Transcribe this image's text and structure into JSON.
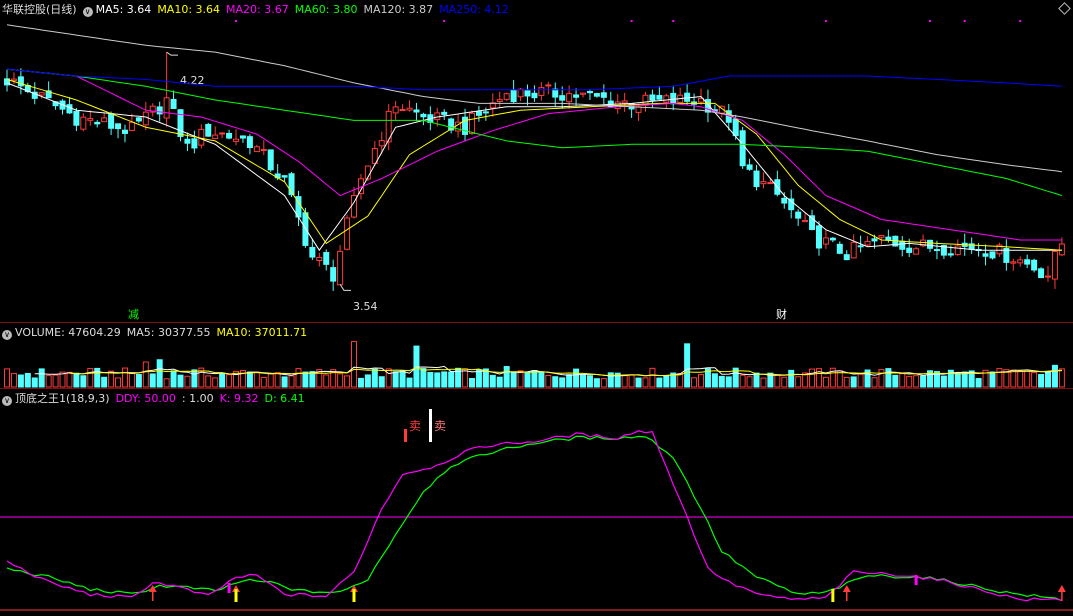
{
  "price_panel": {
    "title": "华联控股(日线)",
    "ma_labels": [
      {
        "text": "MA5: 3.64",
        "color": "#ffffff"
      },
      {
        "text": "MA10: 3.64",
        "color": "#ffff00"
      },
      {
        "text": "MA20: 3.67",
        "color": "#ff00ff"
      },
      {
        "text": "MA60: 3.80",
        "color": "#00ff00"
      },
      {
        "text": "MA120: 3.87",
        "color": "#cccccc"
      },
      {
        "text": "MA250: 4.12",
        "color": "#0000ff"
      }
    ],
    "high_label": "4.22",
    "low_label": "3.54",
    "event_markers": [
      "减",
      "财"
    ]
  },
  "volume_panel": {
    "labels": [
      {
        "text": "VOLUME: 47604.29",
        "color": "#dddddd"
      },
      {
        "text": "MA5: 30377.55",
        "color": "#dddddd"
      },
      {
        "text": "MA10: 37011.71",
        "color": "#ffff00"
      }
    ]
  },
  "indicator_panel": {
    "labels": [
      {
        "text": "顶底之王1(18,9,3)",
        "color": "#dddddd"
      },
      {
        "text": "DDY: 50.00",
        "color": "#ff00ff"
      },
      {
        "text": ": 1.00",
        "color": "#dddddd"
      },
      {
        "text": "K: 9.32",
        "color": "#ff00ff"
      },
      {
        "text": "D: 6.41",
        "color": "#00ff00"
      }
    ],
    "sell_label": "卖"
  },
  "colors": {
    "up": "#ff3b3b",
    "down": "#54ffff",
    "ma5": "#ffffff",
    "ma10": "#ffff00",
    "ma20": "#ff00ff",
    "ma60": "#00ff00",
    "ma120": "#cccccc",
    "ma250": "#0000ff",
    "k": "#ff00ff",
    "d": "#00ff00"
  },
  "chart_data": [
    {
      "type": "candlestick",
      "ylim": [
        3.5,
        4.32
      ],
      "close_anchors": [
        [
          0,
          4.14
        ],
        [
          10,
          4.03
        ],
        [
          18,
          3.99
        ],
        [
          23,
          4.08
        ],
        [
          26,
          3.94
        ],
        [
          29,
          3.99
        ],
        [
          35,
          3.96
        ],
        [
          40,
          3.84
        ],
        [
          44,
          3.62
        ],
        [
          47,
          3.57
        ],
        [
          51,
          3.85
        ],
        [
          56,
          4.07
        ],
        [
          60,
          4.03
        ],
        [
          66,
          4.0
        ],
        [
          72,
          4.1
        ],
        [
          80,
          4.1
        ],
        [
          90,
          4.07
        ],
        [
          100,
          4.08
        ],
        [
          104,
          4.03
        ],
        [
          106,
          3.88
        ],
        [
          111,
          3.8
        ],
        [
          116,
          3.68
        ],
        [
          121,
          3.63
        ],
        [
          126,
          3.67
        ],
        [
          131,
          3.65
        ],
        [
          140,
          3.65
        ],
        [
          145,
          3.62
        ],
        [
          150,
          3.57
        ],
        [
          152,
          3.66
        ]
      ],
      "high": 4.22,
      "low": 3.54,
      "ma_anchors": {
        "ma5": [
          [
            0,
            4.13
          ],
          [
            10,
            4.05
          ],
          [
            20,
            4.03
          ],
          [
            30,
            3.95
          ],
          [
            40,
            3.8
          ],
          [
            45,
            3.64
          ],
          [
            50,
            3.78
          ],
          [
            56,
            4.0
          ],
          [
            62,
            4.03
          ],
          [
            72,
            4.06
          ],
          [
            80,
            4.06
          ],
          [
            90,
            4.07
          ],
          [
            100,
            4.09
          ],
          [
            106,
            3.95
          ],
          [
            112,
            3.8
          ],
          [
            118,
            3.7
          ],
          [
            124,
            3.65
          ],
          [
            130,
            3.66
          ],
          [
            140,
            3.64
          ],
          [
            152,
            3.64
          ]
        ],
        "ma10": [
          [
            0,
            4.14
          ],
          [
            10,
            4.08
          ],
          [
            20,
            4.0
          ],
          [
            30,
            3.96
          ],
          [
            40,
            3.84
          ],
          [
            46,
            3.66
          ],
          [
            52,
            3.74
          ],
          [
            58,
            3.92
          ],
          [
            66,
            4.02
          ],
          [
            74,
            4.05
          ],
          [
            84,
            4.06
          ],
          [
            94,
            4.07
          ],
          [
            102,
            4.07
          ],
          [
            108,
            3.98
          ],
          [
            114,
            3.83
          ],
          [
            120,
            3.73
          ],
          [
            126,
            3.67
          ],
          [
            134,
            3.66
          ],
          [
            144,
            3.65
          ],
          [
            152,
            3.64
          ]
        ],
        "ma20": [
          [
            0,
            4.17
          ],
          [
            10,
            4.15
          ],
          [
            20,
            4.05
          ],
          [
            28,
            4.03
          ],
          [
            36,
            3.98
          ],
          [
            42,
            3.9
          ],
          [
            48,
            3.8
          ],
          [
            54,
            3.85
          ],
          [
            62,
            3.93
          ],
          [
            70,
            3.99
          ],
          [
            78,
            4.04
          ],
          [
            88,
            4.06
          ],
          [
            96,
            4.07
          ],
          [
            100,
            4.06
          ],
          [
            106,
            4.02
          ],
          [
            112,
            3.92
          ],
          [
            118,
            3.8
          ],
          [
            126,
            3.73
          ],
          [
            136,
            3.7
          ],
          [
            146,
            3.67
          ],
          [
            152,
            3.67
          ]
        ],
        "ma60": [
          [
            0,
            4.17
          ],
          [
            10,
            4.15
          ],
          [
            20,
            4.12
          ],
          [
            30,
            4.08
          ],
          [
            40,
            4.05
          ],
          [
            50,
            4.02
          ],
          [
            60,
            4.02
          ],
          [
            66,
            3.99
          ],
          [
            72,
            3.96
          ],
          [
            80,
            3.94
          ],
          [
            90,
            3.95
          ],
          [
            100,
            3.95
          ],
          [
            106,
            3.95
          ],
          [
            116,
            3.94
          ],
          [
            124,
            3.93
          ],
          [
            134,
            3.89
          ],
          [
            144,
            3.85
          ],
          [
            152,
            3.8
          ]
        ],
        "ma120": [
          [
            0,
            4.3
          ],
          [
            10,
            4.27
          ],
          [
            20,
            4.24
          ],
          [
            30,
            4.22
          ],
          [
            40,
            4.18
          ],
          [
            50,
            4.13
          ],
          [
            60,
            4.09
          ],
          [
            68,
            4.07
          ],
          [
            80,
            4.07
          ],
          [
            90,
            4.06
          ],
          [
            100,
            4.05
          ],
          [
            106,
            4.03
          ],
          [
            116,
            3.99
          ],
          [
            124,
            3.96
          ],
          [
            134,
            3.92
          ],
          [
            144,
            3.89
          ],
          [
            152,
            3.87
          ]
        ],
        "ma250": [
          [
            0,
            4.17
          ],
          [
            10,
            4.15
          ],
          [
            20,
            4.14
          ],
          [
            30,
            4.12
          ],
          [
            40,
            4.12
          ],
          [
            50,
            4.12
          ],
          [
            60,
            4.11
          ],
          [
            72,
            4.11
          ],
          [
            84,
            4.11
          ],
          [
            96,
            4.12
          ],
          [
            104,
            4.15
          ],
          [
            114,
            4.15
          ],
          [
            124,
            4.15
          ],
          [
            134,
            4.14
          ],
          [
            144,
            4.13
          ],
          [
            152,
            4.12
          ]
        ]
      }
    },
    {
      "type": "bar",
      "name": "VOLUME",
      "ylim": [
        0,
        110000
      ],
      "base_volume": 30000,
      "spike_volumes": [
        [
          20,
          55000
        ],
        [
          22,
          60000
        ],
        [
          50,
          100000
        ],
        [
          59,
          90000
        ],
        [
          66,
          40000
        ],
        [
          72,
          45000
        ],
        [
          98,
          95000
        ],
        [
          151,
          47604.29
        ]
      ]
    },
    {
      "type": "line",
      "ylim": [
        0,
        100
      ],
      "reference_line": 50.0,
      "k_anchors": [
        [
          0,
          24
        ],
        [
          6,
          12
        ],
        [
          12,
          5
        ],
        [
          18,
          3
        ],
        [
          21,
          12
        ],
        [
          24,
          10
        ],
        [
          29,
          4
        ],
        [
          33,
          15
        ],
        [
          36,
          16
        ],
        [
          40,
          5
        ],
        [
          46,
          4
        ],
        [
          50,
          18
        ],
        [
          54,
          55
        ],
        [
          57,
          75
        ],
        [
          62,
          80
        ],
        [
          66,
          88
        ],
        [
          70,
          92
        ],
        [
          76,
          94
        ],
        [
          82,
          98
        ],
        [
          88,
          96
        ],
        [
          91,
          100
        ],
        [
          93,
          99
        ],
        [
          98,
          50
        ],
        [
          101,
          20
        ],
        [
          104,
          12
        ],
        [
          109,
          4
        ],
        [
          114,
          2
        ],
        [
          118,
          3
        ],
        [
          122,
          18
        ],
        [
          130,
          16
        ],
        [
          136,
          12
        ],
        [
          142,
          6
        ],
        [
          146,
          2
        ],
        [
          152,
          2
        ]
      ],
      "d_anchors": [
        [
          0,
          20
        ],
        [
          6,
          15
        ],
        [
          12,
          8
        ],
        [
          18,
          5
        ],
        [
          22,
          10
        ],
        [
          26,
          9
        ],
        [
          30,
          7
        ],
        [
          34,
          13
        ],
        [
          38,
          12
        ],
        [
          42,
          7
        ],
        [
          48,
          6
        ],
        [
          52,
          14
        ],
        [
          56,
          40
        ],
        [
          60,
          65
        ],
        [
          64,
          80
        ],
        [
          70,
          88
        ],
        [
          76,
          93
        ],
        [
          82,
          96
        ],
        [
          88,
          96
        ],
        [
          92,
          97
        ],
        [
          96,
          85
        ],
        [
          100,
          55
        ],
        [
          103,
          30
        ],
        [
          108,
          15
        ],
        [
          114,
          5
        ],
        [
          118,
          6
        ],
        [
          124,
          16
        ],
        [
          132,
          15
        ],
        [
          138,
          11
        ],
        [
          144,
          6
        ],
        [
          150,
          3
        ],
        [
          152,
          2
        ]
      ],
      "signals": [
        [
          21,
          "red"
        ],
        [
          33,
          "red"
        ],
        [
          33,
          "yellow"
        ],
        [
          50,
          "red"
        ],
        [
          50,
          "yellow"
        ],
        [
          119,
          "yellow"
        ],
        [
          121,
          "red"
        ],
        [
          152,
          "red"
        ]
      ]
    }
  ]
}
